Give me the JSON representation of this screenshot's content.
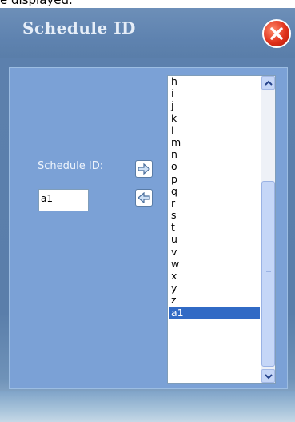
{
  "top_strip_text": "e displayed.",
  "dialog": {
    "title": "Schedule ID",
    "close_icon": "close-icon"
  },
  "form": {
    "schedule_id_label": "Schedule ID:",
    "schedule_id_value": "a1",
    "add_icon": "arrow-right-icon",
    "remove_icon": "arrow-left-icon"
  },
  "list": {
    "items": [
      "h",
      "i",
      "j",
      "k",
      "l",
      "m",
      "n",
      "o",
      "p",
      "q",
      "r",
      "s",
      "t",
      "u",
      "v",
      "w",
      "x",
      "y",
      "z",
      "a1"
    ],
    "selected": "a1"
  },
  "colors": {
    "panel": "#7ba1d6",
    "selection": "#316ac5",
    "close": "#e0301a"
  }
}
